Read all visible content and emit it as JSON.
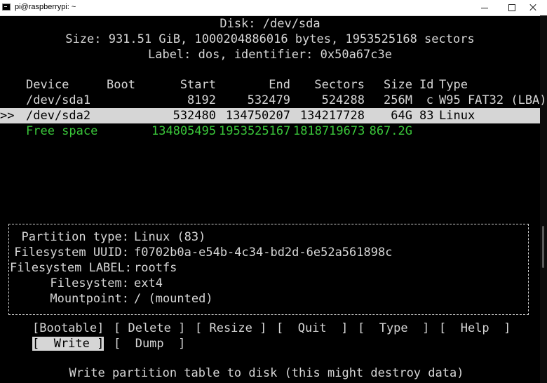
{
  "window": {
    "title": "pi@raspberrypi: ~",
    "icon": "terminal-icon"
  },
  "header": {
    "disk": "Disk: /dev/sda",
    "size": "Size: 931.51 GiB, 1000204886016 bytes, 1953525168 sectors",
    "label": "Label: dos, identifier: 0x50a67c3e"
  },
  "table": {
    "columns": [
      "Device",
      "Boot",
      "Start",
      "End",
      "Sectors",
      "Size",
      "Id",
      "Type"
    ],
    "rows": [
      {
        "marker": "",
        "device": "/dev/sda1",
        "boot": "",
        "start": "8192",
        "end": "532479",
        "sectors": "524288",
        "size": "256M",
        "id": "c",
        "type": "W95 FAT32 (LBA)"
      },
      {
        "marker": ">>",
        "device": "/dev/sda2",
        "boot": "",
        "start": "532480",
        "end": "134750207",
        "sectors": "134217728",
        "size": "64G",
        "id": "83",
        "type": "Linux"
      },
      {
        "marker": "",
        "device": "Free space",
        "boot": "",
        "start": "134805495",
        "end": "1953525167",
        "sectors": "1818719673",
        "size": "867.2G",
        "id": "",
        "type": ""
      }
    ]
  },
  "info": {
    "partition_type_label": "Partition type:",
    "partition_type_value": "Linux (83)",
    "fs_uuid_label": "Filesystem UUID:",
    "fs_uuid_value": "f0702b0a-e54b-4c34-bd2d-6e52a561898c",
    "fs_label_label": "Filesystem LABEL:",
    "fs_label_value": "rootfs",
    "filesystem_label": "Filesystem:",
    "filesystem_value": "ext4",
    "mountpoint_label": "Mountpoint:",
    "mountpoint_value": "/ (mounted)"
  },
  "menu": {
    "bootable": "[Bootable]",
    "delete": "[ Delete ]",
    "resize": "[ Resize ]",
    "quit": "[  Quit  ]",
    "type": "[  Type  ]",
    "help": "[  Help  ]",
    "write": "[  Write ]",
    "dump": "[  Dump  ]",
    "selected": "write"
  },
  "status": "Write partition table to disk (this might destroy data)",
  "colors": {
    "background": "#000000",
    "foreground": "#d6d6d6",
    "highlight": "#d6d6d6",
    "free_space": "#3ac73a"
  }
}
